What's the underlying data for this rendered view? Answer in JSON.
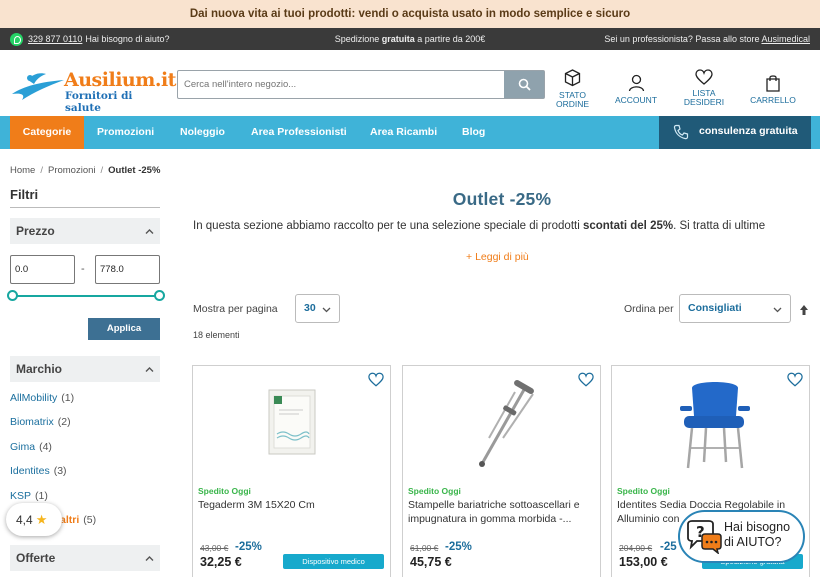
{
  "promo": {
    "text": "Dai nuova vita ai tuoi prodotti: vendi o acquista usato in modo semplice e sicuro"
  },
  "topbar": {
    "phone": "329 877 0110",
    "help_text": "Hai bisogno di aiuto?",
    "shipping_pre": "Spedizione ",
    "shipping_bold": "gratuita",
    "shipping_post": " a partire da 200€",
    "pro_text": "Sei un professionista? Passa allo store ",
    "pro_link": "Ausimedical"
  },
  "header": {
    "logo_brand": "Ausilium.it",
    "logo_tagline": "Fornitori di salute",
    "search_placeholder": "Cerca nell'intero negozio...",
    "icons": {
      "order_status_line1": "STATO",
      "order_status_line2": "ORDINE",
      "account": "ACCOUNT",
      "wishlist_line1": "LISTA",
      "wishlist_line2": "DESIDERI",
      "cart": "CARRELLO"
    }
  },
  "nav": {
    "items": [
      "Categorie",
      "Promozioni",
      "Noleggio",
      "Area Professionisti",
      "Area Ricambi",
      "Blog"
    ],
    "consult": "consulenza gratuita"
  },
  "breadcrumb": {
    "home": "Home",
    "promo": "Promozioni",
    "current": "Outlet -25%"
  },
  "sidebar": {
    "filters_title": "Filtri",
    "price_title": "Prezzo",
    "price_min": "0.0",
    "price_max": "778.0",
    "price_range_min_fraction": 0,
    "price_range_max_fraction": 1,
    "apply": "Applica",
    "brand_title": "Marchio",
    "brands": [
      {
        "name": "AllMobility",
        "count": "(1)"
      },
      {
        "name": "Biomatrix",
        "count": "(2)"
      },
      {
        "name": "Gima",
        "count": "(4)"
      },
      {
        "name": "Identites",
        "count": "(3)"
      },
      {
        "name": "KSP",
        "count": "(1)"
      }
    ],
    "more_label": "altri",
    "more_count": "(5)",
    "offers_title": "Offerte",
    "rating_value": "4,4"
  },
  "main": {
    "title": "Outlet -25%",
    "intro_pre": "In questa sezione abbiamo raccolto per te una selezione speciale di prodotti ",
    "intro_bold": "scontati del 25%",
    "intro_post": ". Si tratta di ultime",
    "read_more": "Leggi di più",
    "per_page_label": "Mostra per pagina",
    "per_page_value": "30",
    "item_count": "18 elementi",
    "sort_label": "Ordina per",
    "sort_value": "Consigliati"
  },
  "products": [
    {
      "shipping": "Spedito Oggi",
      "name": "Tegaderm 3M 15X20 Cm",
      "old_price": "43,00 €",
      "discount": "-25%",
      "price": "32,25 €",
      "badge": "Dispositivo medico"
    },
    {
      "shipping": "Spedito Oggi",
      "name": "Stampelle bariatriche sottoascellari e impugnatura in gomma morbida -...",
      "old_price": "61,00 €",
      "discount": "-25%",
      "price": "45,75 €",
      "badge": ""
    },
    {
      "shipping": "Spedito Oggi",
      "name": "Identites Sedia Doccia Regolabile in Alluminio con",
      "old_price": "204,00 €",
      "discount": "-25",
      "price": "153,00 €",
      "badge": "Spedizione gratuita"
    }
  ],
  "chat": {
    "line1": "Hai bisogno",
    "line2": "di AIUTO?"
  },
  "colors": {
    "orange": "#f07d19",
    "nav_blue": "#3fb3d8",
    "dark_blue": "#205a78",
    "teal": "#17a7a0",
    "green": "#39b54a"
  }
}
